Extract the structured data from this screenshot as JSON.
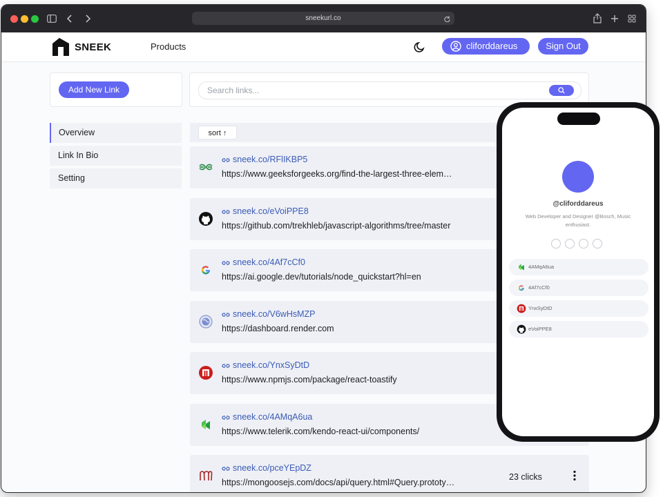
{
  "browser": {
    "url": "sneekurl.co"
  },
  "navbar": {
    "brand": "SNEEK",
    "products_label": "Products",
    "username": "cliforddareus",
    "signout_label": "Sign Out"
  },
  "toolbar": {
    "add_link_label": "Add New Link",
    "search_placeholder": "Search links..."
  },
  "sidebar": {
    "items": [
      {
        "label": "Overview",
        "active": true
      },
      {
        "label": "Link In Bio",
        "active": false
      },
      {
        "label": "Setting",
        "active": false
      }
    ]
  },
  "list": {
    "sort_label": "sort",
    "links": [
      {
        "short": "sneek.co/RFlIKBP5",
        "url": "https://www.geeksforgeeks.org/find-the-largest-three-elements-in-an-array/",
        "icon": "geeksforgeeks-icon",
        "clicks": ""
      },
      {
        "short": "sneek.co/eVoiPPE8",
        "url": "https://github.com/trekhleb/javascript-algorithms/tree/master",
        "icon": "github-icon",
        "clicks": ""
      },
      {
        "short": "sneek.co/4Af7cCf0",
        "url": "https://ai.google.dev/tutorials/node_quickstart?hl=en",
        "icon": "google-icon",
        "clicks": ""
      },
      {
        "short": "sneek.co/V6wHsMZP",
        "url": "https://dashboard.render.com",
        "icon": "globe-icon",
        "clicks": ""
      },
      {
        "short": "sneek.co/YnxSyDtD",
        "url": "https://www.npmjs.com/package/react-toastify",
        "icon": "npm-icon",
        "clicks": ""
      },
      {
        "short": "sneek.co/4AMqA6ua",
        "url": "https://www.telerik.com/kendo-react-ui/components/",
        "icon": "telerik-icon",
        "clicks": ""
      },
      {
        "short": "sneek.co/pceYEpDZ",
        "url": "https://mongoosejs.com/docs/api/query.html#Query.prototype.find()",
        "icon": "mongoose-icon",
        "clicks": "23 clicks"
      }
    ]
  },
  "phone_preview": {
    "username": "@cliforddareus",
    "bio": "Web Developer and Designer @Bosch, Music enthusiast.",
    "links": [
      {
        "label": "4AMqA6ua",
        "icon": "telerik-icon"
      },
      {
        "label": "4Af7cCf0",
        "icon": "google-icon"
      },
      {
        "label": "YnxSyDtD",
        "icon": "npm-icon"
      },
      {
        "label": "eVoiPPE8",
        "icon": "github-icon"
      }
    ]
  },
  "colors": {
    "accent": "#6366f1",
    "link": "#3b5bb5",
    "row_bg": "#eef0f6"
  }
}
